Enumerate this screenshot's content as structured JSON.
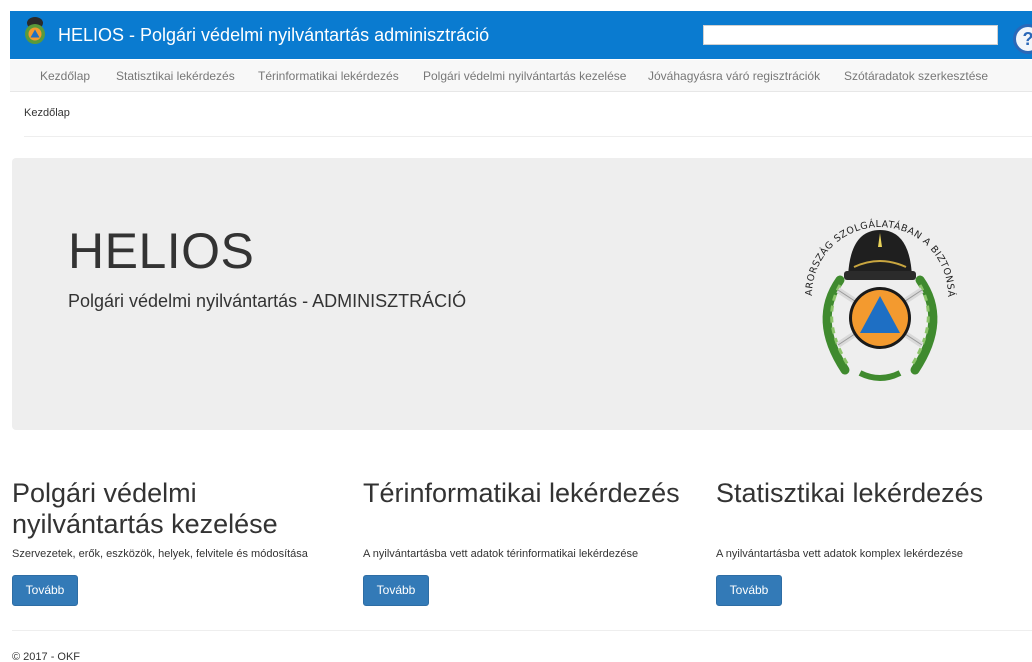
{
  "header": {
    "app_title": "HELIOS - Polgári védelmi nyilvántartás adminisztráció",
    "search": {
      "value": "",
      "placeholder": ""
    },
    "help_icon": "?",
    "brand_color": "#0a7bd0"
  },
  "nav": {
    "items": [
      {
        "label": "Kezdőlap"
      },
      {
        "label": "Statisztikai lekérdezés"
      },
      {
        "label": "Térinformatikai lekérdezés"
      },
      {
        "label": "Polgári védelmi nyilvántartás kezelése"
      },
      {
        "label": "Jóváhagyásra váró regisztrációk"
      },
      {
        "label": "Szótáradatok szerkesztése"
      }
    ]
  },
  "breadcrumb": "Kezdőlap",
  "jumbotron": {
    "title": "HELIOS",
    "subtitle": "Polgári védelmi nyilvántartás - ADMINISZTRÁCIÓ",
    "emblem_text": "MAGYARORSZÁG SZOLGÁLATÁBAN A BIZTONSÁGÉRT"
  },
  "columns": [
    {
      "title": "Polgári védelmi nyilvántartás kezelése",
      "description": "Szervezetek, erők, eszközök, helyek, felvitele és módosítása",
      "button": "Tovább"
    },
    {
      "title": "Térinformatikai lekérdezés",
      "description": "A nyilvántartásba vett adatok térinformatikai lekérdezése",
      "button": "Tovább"
    },
    {
      "title": "Statisztikai lekérdezés",
      "description": "A nyilvántartásba vett adatok komplex lekérdezése",
      "button": "Tovább"
    }
  ],
  "footer": "© 2017 - OKF",
  "colors": {
    "primary_button": "#337ab7",
    "jumbotron_bg": "#eeeeee",
    "emblem_orange": "#f39a2f",
    "emblem_blue": "#1e6fc4"
  }
}
